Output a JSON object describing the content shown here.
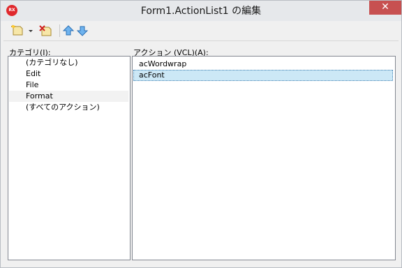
{
  "window": {
    "title": "Form1.ActionList1 の編集",
    "app_icon_text": "RX",
    "close_glyph": "✕"
  },
  "toolbar": {
    "buttons": [
      "new-action-icon",
      "dropdown-arrow-icon",
      "delete-action-icon",
      "move-up-icon",
      "move-down-icon"
    ]
  },
  "categories": {
    "label": "カテゴリ(I):",
    "items": [
      "(カテゴリなし)",
      "Edit",
      "File",
      "Format",
      "(すべてのアクション)"
    ],
    "selected_index": 3
  },
  "actions": {
    "label": "アクション (VCL)(A):",
    "items": [
      "acWordwrap",
      "acFont"
    ],
    "selected_index": 1
  },
  "colors": {
    "selection_bg": "#cce8f6",
    "close_button": "#c75050",
    "arrow_blue": "#3b8fd9"
  }
}
